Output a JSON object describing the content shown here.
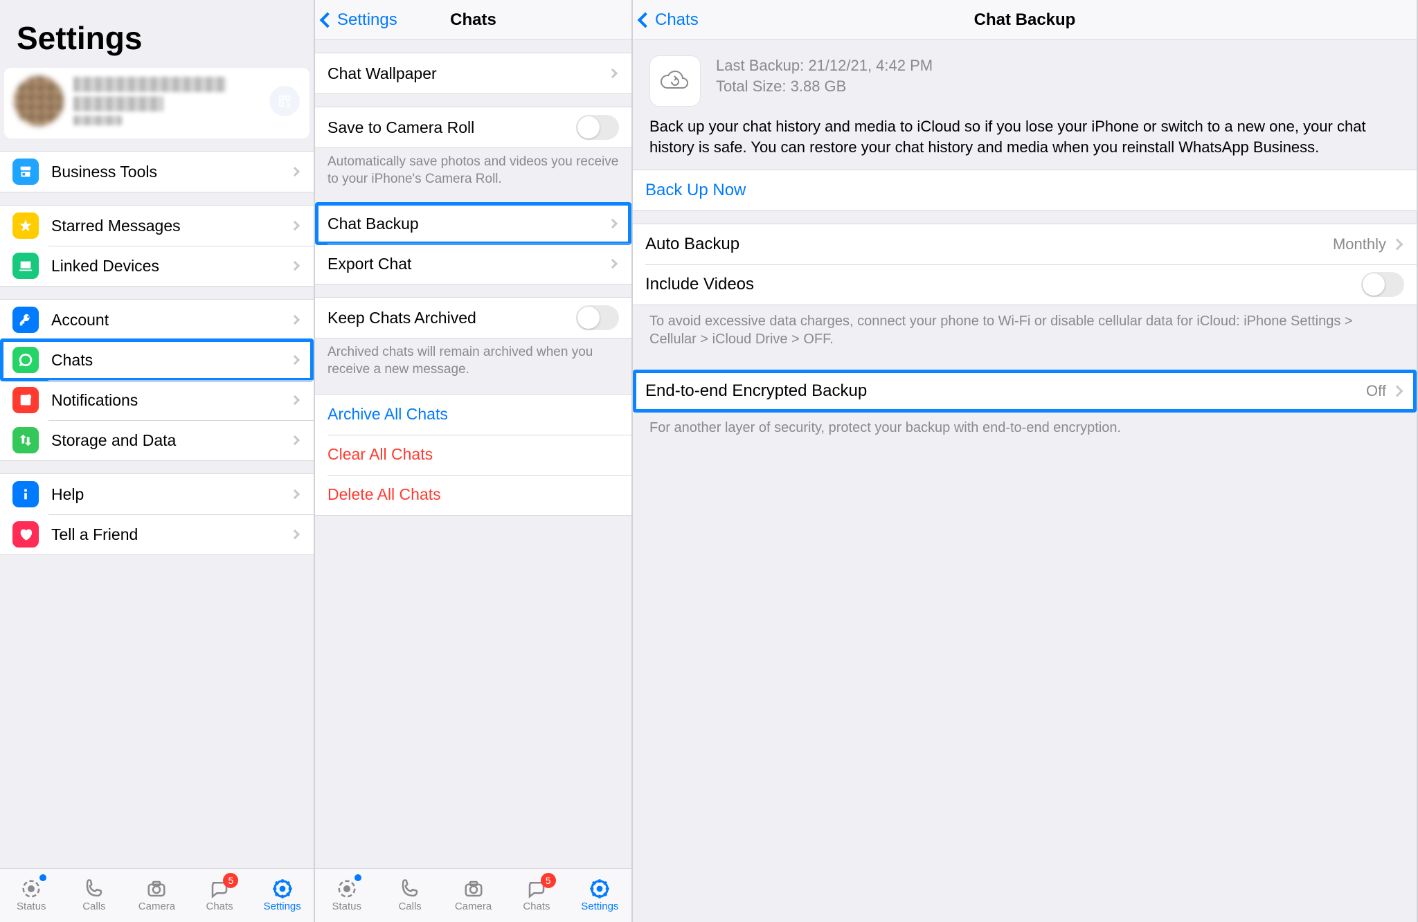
{
  "screen1": {
    "title": "Settings",
    "qr_icon": "qr-code-icon",
    "groups": [
      {
        "items": [
          {
            "icon_bg": "#1fa4ff",
            "name": "business-tools",
            "label": "Business Tools"
          }
        ]
      },
      {
        "items": [
          {
            "icon_bg": "#ffcc00",
            "name": "starred-messages",
            "label": "Starred Messages"
          },
          {
            "icon_bg": "#17c97d",
            "name": "linked-devices",
            "label": "Linked Devices"
          }
        ]
      },
      {
        "items": [
          {
            "icon_bg": "#007aff",
            "name": "account",
            "label": "Account"
          },
          {
            "icon_bg": "#25d366",
            "name": "chats",
            "label": "Chats",
            "highlight": true
          },
          {
            "icon_bg": "#ff3b30",
            "name": "notifications",
            "label": "Notifications"
          },
          {
            "icon_bg": "#34c759",
            "name": "storage-and-data",
            "label": "Storage and Data"
          }
        ]
      },
      {
        "items": [
          {
            "icon_bg": "#007aff",
            "name": "help",
            "label": "Help"
          },
          {
            "icon_bg": "#ff2d55",
            "name": "tell-a-friend",
            "label": "Tell a Friend"
          }
        ]
      }
    ]
  },
  "screen2": {
    "back": "Settings",
    "title": "Chats",
    "sections": [
      {
        "rows": [
          {
            "type": "disclosure",
            "name": "chat-wallpaper",
            "label": "Chat Wallpaper"
          }
        ]
      },
      {
        "rows": [
          {
            "type": "toggle",
            "name": "save-camera-roll",
            "label": "Save to Camera Roll"
          }
        ],
        "footer": "Automatically save photos and videos you receive to your iPhone's Camera Roll."
      },
      {
        "rows": [
          {
            "type": "disclosure",
            "name": "chat-backup",
            "label": "Chat Backup",
            "highlight": true
          },
          {
            "type": "disclosure",
            "name": "export-chat",
            "label": "Export Chat"
          }
        ]
      },
      {
        "rows": [
          {
            "type": "toggle",
            "name": "keep-archived",
            "label": "Keep Chats Archived"
          }
        ],
        "footer": "Archived chats will remain archived when you receive a new message."
      },
      {
        "rows": [
          {
            "type": "action",
            "name": "archive-all",
            "label": "Archive All Chats",
            "color": "blue"
          },
          {
            "type": "action",
            "name": "clear-all",
            "label": "Clear All Chats",
            "color": "red"
          },
          {
            "type": "action",
            "name": "delete-all",
            "label": "Delete All Chats",
            "color": "red"
          }
        ]
      }
    ]
  },
  "screen3": {
    "back": "Chats",
    "title": "Chat Backup",
    "last_backup_label": "Last Backup: ",
    "last_backup_value": "21/12/21, 4:42 PM",
    "total_size_label": "Total Size: ",
    "total_size_value": "3.88 GB",
    "description": "Back up your chat history and media to iCloud so if you lose your iPhone or switch to a new one, your chat history is safe. You can restore your chat history and media when you reinstall WhatsApp Business.",
    "backup_now": "Back Up Now",
    "auto_backup_label": "Auto Backup",
    "auto_backup_value": "Monthly",
    "include_videos_label": "Include Videos",
    "data_footer": "To avoid excessive data charges, connect your phone to Wi-Fi or disable cellular data for iCloud: iPhone Settings > Cellular > iCloud Drive > OFF.",
    "e2e_label": "End-to-end Encrypted Backup",
    "e2e_value": "Off",
    "e2e_footer": "For another layer of security, protect your backup with end-to-end encryption."
  },
  "tabbar": {
    "items": [
      {
        "name": "status",
        "label": "Status",
        "dot": true
      },
      {
        "name": "calls",
        "label": "Calls"
      },
      {
        "name": "camera",
        "label": "Camera"
      },
      {
        "name": "chats",
        "label": "Chats",
        "badge": "5"
      },
      {
        "name": "settings",
        "label": "Settings",
        "active": true
      }
    ]
  }
}
